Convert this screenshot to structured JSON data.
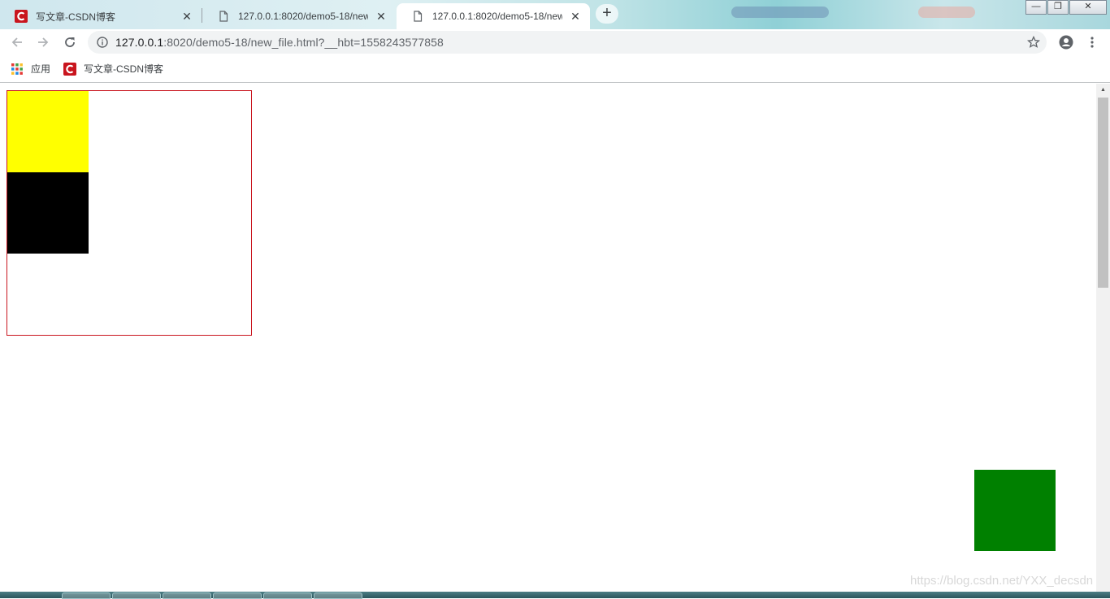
{
  "browser": {
    "tabs": [
      {
        "title": "写文章-CSDN博客",
        "favicon": "csdn-icon",
        "active": false
      },
      {
        "title": "127.0.0.1:8020/demo5-18/new",
        "favicon": "page-icon",
        "active": false
      },
      {
        "title": "127.0.0.1:8020/demo5-18/new",
        "favicon": "page-icon",
        "active": true
      }
    ],
    "close_glyph": "✕",
    "new_tab_glyph": "+",
    "window_controls": {
      "minimize": "—",
      "restore": "❐",
      "close": "✕"
    },
    "address": {
      "host": "127.0.0.1",
      "rest": ":8020/demo5-18/new_file.html?__hbt=1558243577858"
    },
    "bookmarks": [
      {
        "label": "应用",
        "icon": "apps-grid-icon"
      },
      {
        "label": "写文章-CSDN博客",
        "icon": "csdn-icon"
      }
    ]
  },
  "page": {
    "container_border_color": "#c9151e",
    "boxes": [
      {
        "name": "yellow-box",
        "color": "#ffff00"
      },
      {
        "name": "black-box",
        "color": "#000000"
      },
      {
        "name": "green-box",
        "color": "#008000"
      }
    ]
  },
  "watermark": "https://blog.csdn.net/YXX_decsdn"
}
